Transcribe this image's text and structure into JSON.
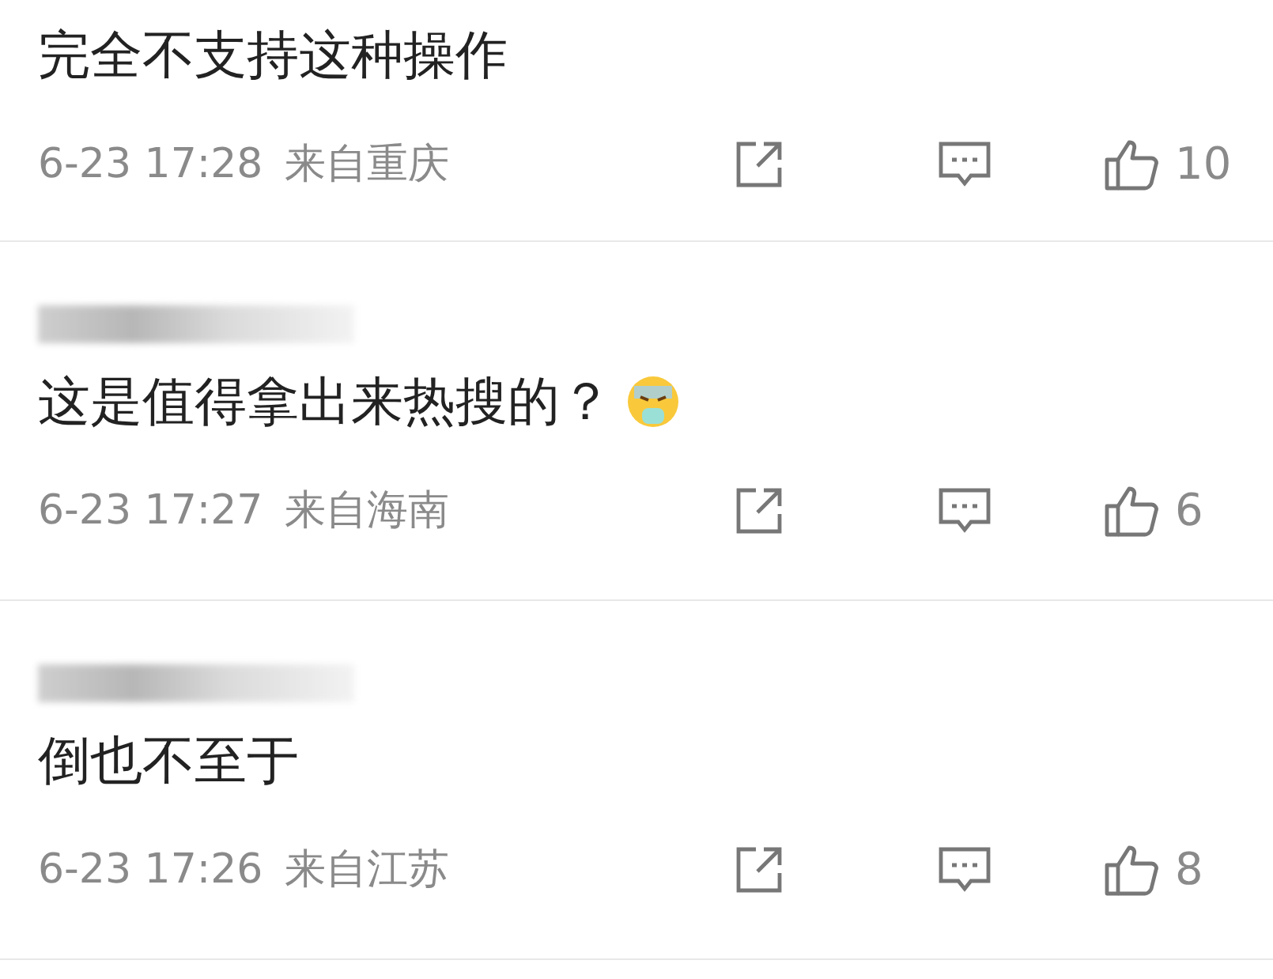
{
  "comments": [
    {
      "text": "完全不支持这种操作",
      "time": "6-23 17:28",
      "location": "来自重庆",
      "likes": "10"
    },
    {
      "name_hidden": true,
      "text": "这是值得拿出来热搜的？",
      "emoji": true,
      "time": "6-23 17:27",
      "location": "来自海南",
      "likes": "6"
    },
    {
      "name_hidden": true,
      "text": "倒也不至于",
      "time": "6-23 17:26",
      "location": "来自江苏",
      "likes": "8"
    }
  ]
}
